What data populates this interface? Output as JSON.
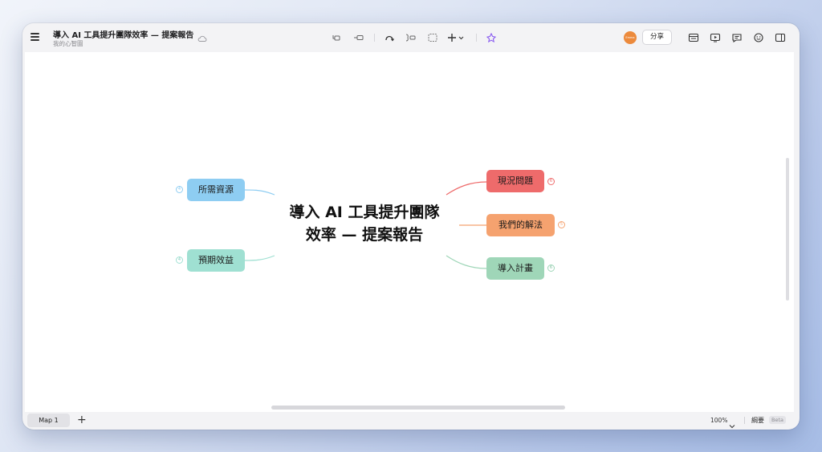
{
  "header": {
    "title": "導入 AI 工具提升團隊效率 — 提案報告",
    "subtitle": "我的心智圖",
    "share_label": "分享",
    "avatar_initials": "Emma"
  },
  "toolbar_icons": [
    "topic-icon",
    "subtopic-icon",
    "relationship-icon",
    "boundary-icon",
    "summary-icon",
    "insert-icon",
    "ai-sparkle-icon"
  ],
  "right_icons": [
    "outline-view-icon",
    "presentation-icon",
    "comments-icon",
    "emoji-icon",
    "sidebar-panel-icon"
  ],
  "mindmap": {
    "central_line1": "導入 AI 工具提升團隊",
    "central_line2": "效率 — 提案報告",
    "topics": {
      "current_problem": "現況問題",
      "our_solution": "我們的解法",
      "implementation_plan": "導入計畫",
      "required_resources": "所需資源",
      "expected_benefits": "預期效益"
    },
    "colors": {
      "current_problem": "#ee6b6b",
      "our_solution": "#f5a26f",
      "implementation_plan": "#9fd6b8",
      "required_resources": "#8ecdf2",
      "expected_benefits": "#9fe0d2"
    }
  },
  "footer": {
    "sheet_tab": "Map 1",
    "add_sheet": "+",
    "zoom": "100%",
    "outline_label": "綱要",
    "beta_label": "Beta"
  }
}
